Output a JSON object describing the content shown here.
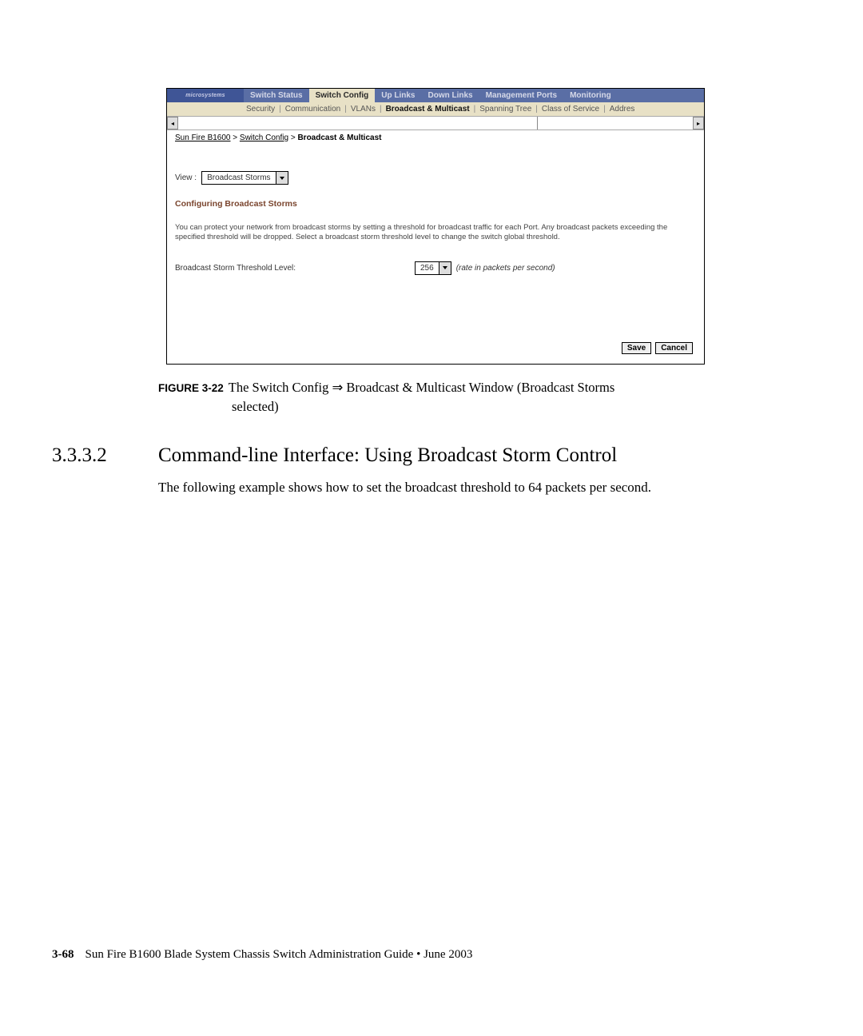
{
  "logo": "microsystems",
  "primary_tabs": {
    "t0": "Switch Status",
    "t1": "Switch Config",
    "t2": "Up Links",
    "t3": "Down Links",
    "t4": "Management Ports",
    "t5": "Monitoring"
  },
  "secondary_tabs": {
    "s0": "Security",
    "s1": "Communication",
    "s2": "VLANs",
    "s3": "Broadcast & Multicast",
    "s4": "Spanning Tree",
    "s5": "Class of Service",
    "s6": "Addres"
  },
  "scroll": {
    "left": "◂",
    "right": "▸"
  },
  "breadcrumb": {
    "a": "Sun Fire B1600",
    "b": "Switch Config",
    "c": "Broadcast & Multicast",
    "gt": ">"
  },
  "view": {
    "label": "View :",
    "value": "Broadcast Storms"
  },
  "section_heading": "Configuring Broadcast Storms",
  "description": "You can protect your network from broadcast storms by setting a threshold for broadcast traffic for each Port. Any broadcast packets exceeding the specified threshold will be dropped. Select a broadcast storm threshold level to change the switch global threshold.",
  "threshold": {
    "label": "Broadcast Storm Threshold Level:",
    "value": "256",
    "hint": "(rate in packets per second)"
  },
  "buttons": {
    "save": "Save",
    "cancel": "Cancel"
  },
  "caption": {
    "figlabel": "FIGURE 3-22",
    "line1": "The Switch Config ⇒ Broadcast & Multicast Window (Broadcast Storms",
    "line2": "selected)"
  },
  "section": {
    "number": "3.3.3.2",
    "title": "Command-line Interface: Using Broadcast Storm Control"
  },
  "paragraph": "The following example shows how to set the broadcast threshold to 64 packets per second.",
  "footer": {
    "page": "3-68",
    "text": "Sun Fire B1600 Blade System Chassis Switch Administration Guide • June 2003"
  }
}
